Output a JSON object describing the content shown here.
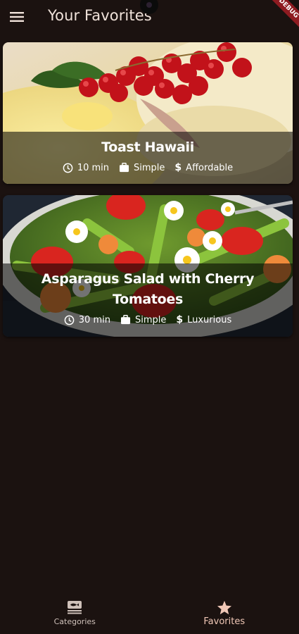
{
  "app_bar": {
    "title": "Your Favorites",
    "menu_icon": "menu-icon",
    "debug_banner": "DEBUG"
  },
  "meals": [
    {
      "title": "Toast Hawaii",
      "duration": "10 min",
      "complexity": "Simple",
      "affordability": "Affordable"
    },
    {
      "title": "Asparagus Salad with Cherry Tomatoes",
      "duration": "30 min",
      "complexity": "Simple",
      "affordability": "Luxurious"
    }
  ],
  "bottom_nav": {
    "items": [
      {
        "label": "Categories",
        "icon": "set-meal-icon",
        "active": false
      },
      {
        "label": "Favorites",
        "icon": "star-icon",
        "active": true
      }
    ]
  },
  "colors": {
    "background": "#1b1210",
    "active_nav": "#f0c7b6",
    "inactive_nav": "#cfc1ba",
    "overlay": "rgba(0,0,0,0.55)"
  }
}
